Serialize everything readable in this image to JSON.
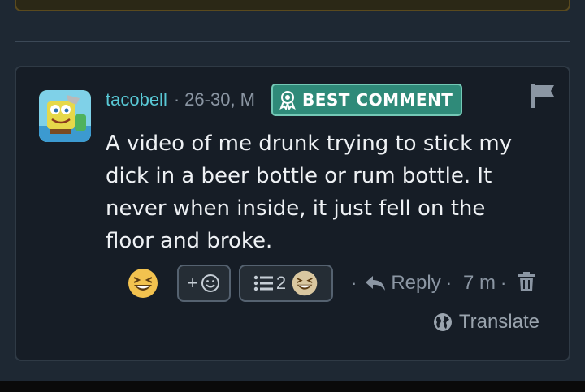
{
  "comment": {
    "username": "tacobell",
    "meta_separator": "·",
    "age_gender": "26-30, M",
    "badge_label": "BEST COMMENT",
    "text": "A video of me drunk trying to stick my dick in a beer bottle or rum bottle. It never when inside, it just fell on the floor and broke.",
    "actions": {
      "add_reaction_label": "+",
      "reactions_count": "2",
      "reply_label": "Reply",
      "time": "7 m",
      "separator": "·"
    },
    "translate_label": "Translate"
  },
  "icons": {
    "avatar": "spongebob-avatar",
    "badge": "award-ribbon-icon",
    "report": "flag-icon",
    "reaction": "laughing-emoji-icon",
    "add_reaction": "smiley-icon",
    "list": "list-icon",
    "reply": "reply-arrow-icon",
    "delete": "trash-icon",
    "translate": "globe-icon"
  },
  "colors": {
    "background": "#1e2833",
    "card": "#161d26",
    "username": "#59c9d6",
    "badge": "#2f8a79",
    "text": "#eef1f4",
    "muted": "#8b96a3"
  }
}
